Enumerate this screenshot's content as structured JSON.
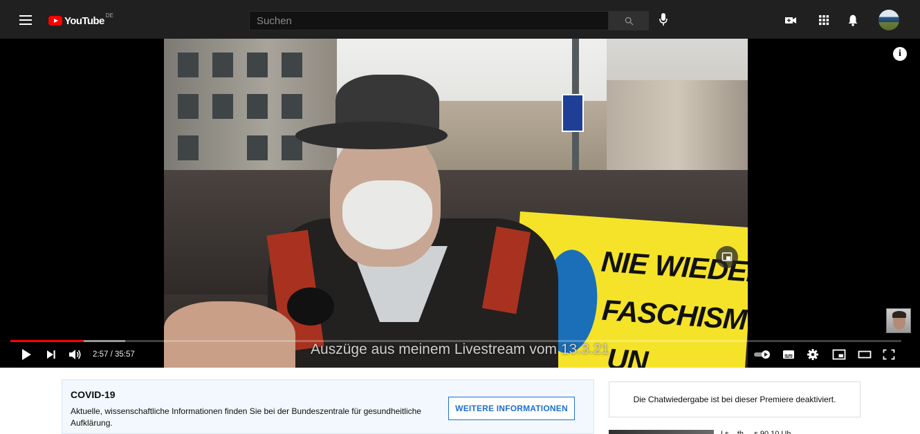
{
  "header": {
    "logo_text": "YouTube",
    "country_code": "DE",
    "search_placeholder": "Suchen",
    "icons": [
      "menu-icon",
      "search-icon",
      "microphone-icon",
      "create-video-icon",
      "apps-grid-icon",
      "notifications-bell-icon",
      "account-avatar"
    ]
  },
  "player": {
    "caption": "Auszüge aus meinem Livestream vom 13.3.21",
    "time_display": "2:57 / 35:57",
    "current_time": "2:57",
    "duration": "35:57",
    "progress_fraction": 0.0821,
    "buffered_fraction": 0.129,
    "video_overlay_text": [
      "NIE WIEDER",
      "FASCHISMU",
      "UN"
    ],
    "controls": [
      "play-icon",
      "next-icon",
      "volume-icon",
      "autoplay-toggle",
      "subtitles-icon",
      "settings-gear-icon",
      "miniplayer-icon",
      "theater-mode-icon",
      "fullscreen-icon"
    ],
    "accent_color": "#ff0000"
  },
  "covid_panel": {
    "title": "COVID-19",
    "body": "Aktuelle, wissenschaftliche Informationen finden Sie bei der Bundeszentrale für gesundheitliche Aufklärung.",
    "button_label": "WEITERE INFORMATIONEN"
  },
  "chat": {
    "notice": "Die Chatwiedergabe ist bei dieser Premiere deaktiviert."
  },
  "related": {
    "first_title_partial": "Ls....th.....s 90 10 Uh..."
  }
}
